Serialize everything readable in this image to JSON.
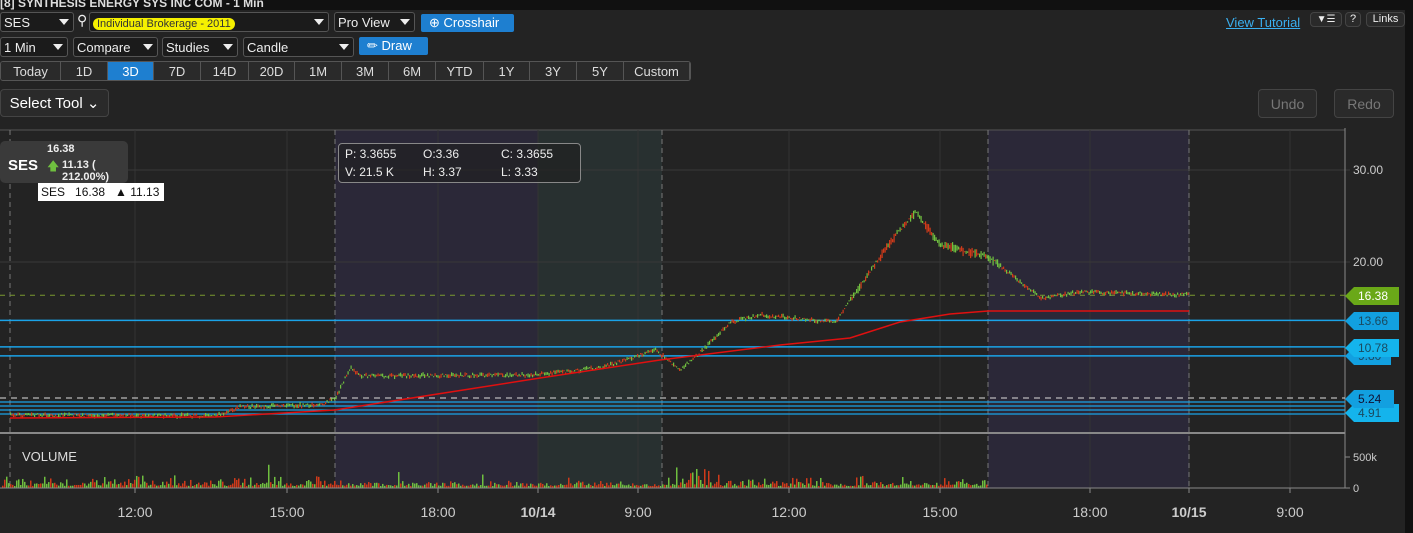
{
  "window": {
    "title": "[8] SYNTHESIS ENERGY SYS INC COM - 1 Min"
  },
  "toolbar": {
    "symbol": "SES",
    "account": "Individual Brokerage - 2011",
    "view": "Pro View",
    "crosshair": "Crosshair",
    "view_tutorial": "View Tutorial",
    "help": "?",
    "links": "Links",
    "interval": "1 Min",
    "compare": "Compare",
    "studies": "Studies",
    "chart_type": "Candle",
    "draw": "Draw"
  },
  "ranges": [
    {
      "label": "Today"
    },
    {
      "label": "1D"
    },
    {
      "label": "3D",
      "active": true
    },
    {
      "label": "7D"
    },
    {
      "label": "14D"
    },
    {
      "label": "20D"
    },
    {
      "label": "1M"
    },
    {
      "label": "3M"
    },
    {
      "label": "6M"
    },
    {
      "label": "YTD"
    },
    {
      "label": "1Y"
    },
    {
      "label": "3Y"
    },
    {
      "label": "5Y"
    },
    {
      "label": "Custom"
    }
  ],
  "tools": {
    "select_tool": "Select Tool",
    "undo": "Undo",
    "redo": "Redo"
  },
  "quote": {
    "symbol": "SES",
    "last": "16.38",
    "change": "11.13 ( 212.00%)",
    "legend": "SES   16.38   ▲ 11.13"
  },
  "ohlc": {
    "p": "P: 3.3655",
    "o": "O:3.36",
    "c": "C: 3.3655",
    "v": "V: 21.5 K",
    "h": "H: 3.37",
    "l": "L: 3.33"
  },
  "chart_data": {
    "type": "candlestick",
    "price_axis": {
      "ticks": [
        "30.00",
        "20.00"
      ],
      "tick_values": [
        30,
        20
      ]
    },
    "volume_axis": {
      "label": "VOLUME",
      "ticks": [
        "500k",
        "0"
      ]
    },
    "x_ticks": [
      "12:00",
      "15:00",
      "18:00",
      "10/14",
      "9:00",
      "12:00",
      "15:00",
      "18:00",
      "10/15",
      "9:00"
    ],
    "x_ticks_bold": [
      false,
      false,
      false,
      true,
      false,
      false,
      false,
      false,
      true,
      false
    ],
    "last_price": {
      "value": 16.38,
      "label": "16.38",
      "color": "#6aa818"
    },
    "levels": [
      {
        "value": 13.66,
        "label": "13.66"
      },
      {
        "value": 10.78,
        "label": "10.78"
      },
      {
        "value": 9.8,
        "label": "9.80"
      },
      {
        "value": 5.24,
        "label": "5.24"
      },
      {
        "value": 4.91,
        "label": "4.91"
      }
    ],
    "colors": {
      "up": "#6fbf3f",
      "down": "#d03a1a",
      "ma": "#e01010",
      "level": "#1aa3e8"
    }
  }
}
